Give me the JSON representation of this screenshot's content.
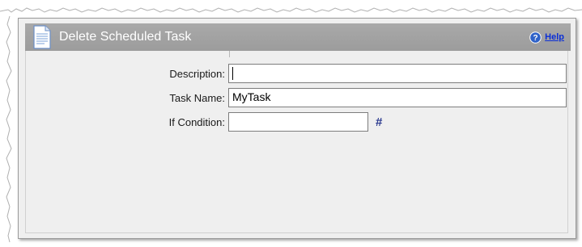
{
  "dialog": {
    "title": "Delete Scheduled Task",
    "help_label": "Help"
  },
  "form": {
    "description": {
      "label": "Description:",
      "value": ""
    },
    "task_name": {
      "label": "Task Name:",
      "value": "MyTask"
    },
    "if_condition": {
      "label": "If Condition:",
      "value": "",
      "expr_button": "#"
    }
  },
  "colors": {
    "titlebar": "#a3a3a3",
    "panel": "#efefef",
    "help_link": "#0b2fd6",
    "expr_button": "#2b3a8f"
  },
  "icons": [
    "document-icon",
    "help-icon",
    "expression-icon"
  ]
}
